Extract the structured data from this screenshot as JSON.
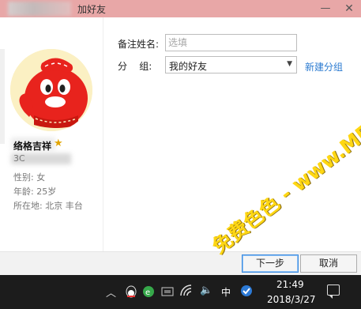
{
  "window": {
    "title": "加好友",
    "minimize_glyph": "—",
    "close_glyph": "✕"
  },
  "profile": {
    "nickname": "络格吉祥",
    "qq_number_partial": "3C",
    "gender": "性别: 女",
    "age": "年龄: 25岁",
    "location": "所在地: 北京  丰台"
  },
  "form": {
    "remark_label": "备注姓名:",
    "remark_placeholder": "选填",
    "group_label": "分    组:",
    "group_value": "我的好友",
    "new_group_link": "新建分组"
  },
  "buttons": {
    "next": "下一步",
    "cancel": "取消"
  },
  "taskbar": {
    "ime": "中",
    "time": "21:49",
    "date": "2018/3/27"
  },
  "watermark": "免费色色 - www.MFsese.com",
  "colors": {
    "titlebar": "#e8a7a7",
    "accent_link": "#2b7bd1",
    "avatar_red": "#e8231d",
    "avatar_bg": "#fbf0c3",
    "watermark": "#ffd400"
  },
  "icons": [
    "qq-penguin-icon",
    "chevron-up-icon",
    "browser-icon",
    "network-icon",
    "wifi-icon",
    "volume-icon",
    "ime-icon",
    "notification-icon",
    "star-icon"
  ]
}
